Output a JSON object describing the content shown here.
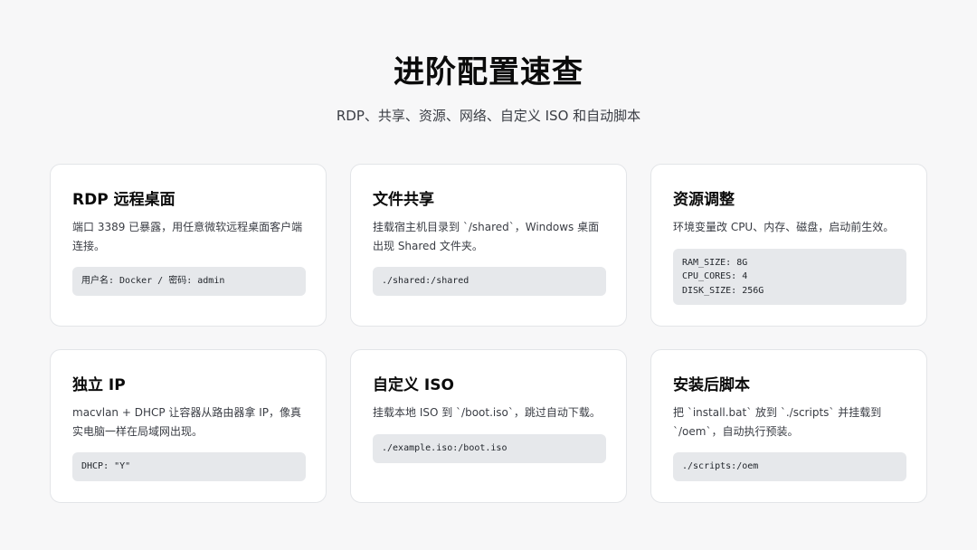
{
  "header": {
    "title": "进阶配置速查",
    "subtitle": "RDP、共享、资源、网络、自定义 ISO 和自动脚本"
  },
  "cards": [
    {
      "title": "RDP 远程桌面",
      "desc": "端口 3389 已暴露，用任意微软远程桌面客户端连接。",
      "code": [
        "用户名: Docker / 密码: admin"
      ]
    },
    {
      "title": "文件共享",
      "desc": "挂载宿主机目录到 `/shared`，Windows 桌面出现 Shared 文件夹。",
      "code": [
        "./shared:/shared"
      ]
    },
    {
      "title": "资源调整",
      "desc": "环境变量改 CPU、内存、磁盘，启动前生效。",
      "code": [
        "RAM_SIZE: 8G",
        "CPU_CORES: 4",
        "DISK_SIZE: 256G"
      ]
    },
    {
      "title": "独立 IP",
      "desc": "macvlan + DHCP 让容器从路由器拿 IP，像真实电脑一样在局域网出现。",
      "code": [
        "DHCP: \"Y\""
      ]
    },
    {
      "title": "自定义 ISO",
      "desc": "挂载本地 ISO 到 `/boot.iso`，跳过自动下载。",
      "code": [
        "./example.iso:/boot.iso"
      ]
    },
    {
      "title": "安装后脚本",
      "desc": "把 `install.bat` 放到 `./scripts` 并挂载到 `/oem`，自动执行预装。",
      "code": [
        "./scripts:/oem"
      ]
    }
  ]
}
